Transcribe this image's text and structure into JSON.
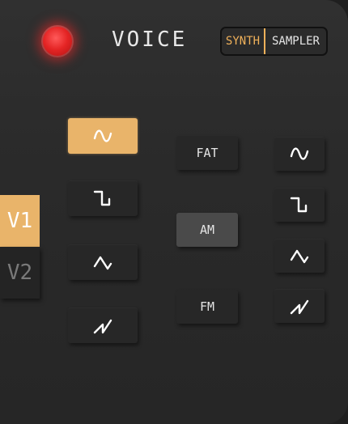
{
  "header": {
    "title": "VOICE",
    "power_led": "red-led-indicator",
    "mode_switch": {
      "options": [
        "SYNTH",
        "SAMPLER"
      ],
      "selected": "SYNTH"
    }
  },
  "voices": {
    "tabs": [
      "V1",
      "V2"
    ],
    "selected": "V1"
  },
  "osc1": {
    "waveforms": [
      "sine-icon",
      "square-icon",
      "triangle-icon",
      "sawtooth-icon"
    ],
    "selected": "sine-icon"
  },
  "modulation": {
    "options": [
      "FAT",
      "AM",
      "FM"
    ],
    "selected": "AM"
  },
  "osc2": {
    "waveforms": [
      "sine-icon",
      "square-icon",
      "triangle-icon",
      "sawtooth-icon"
    ],
    "selected": null
  },
  "colors": {
    "accent": "#e9b46a",
    "led": "#e42424",
    "background": "#2b2b2b",
    "icon": "#ffffff"
  }
}
